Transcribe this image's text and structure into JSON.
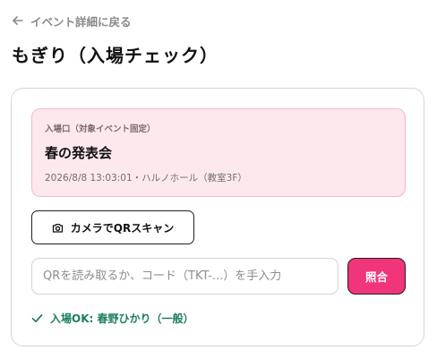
{
  "back_link": {
    "label": "イベント詳細に戻る",
    "icon": "arrow-left-icon"
  },
  "page": {
    "title": "もぎり（入場チェック）"
  },
  "event": {
    "label": "入場口（対象イベント固定）",
    "name": "春の発表会",
    "meta": "2026/8/8 13:03:01・ハルノホール（教室3F）"
  },
  "scanner": {
    "button_label": "カメラでQRスキャン",
    "icon": "camera-icon"
  },
  "manual_entry": {
    "placeholder": "QRを読み取るか、コード（TKT-...）を手入力",
    "value": "",
    "submit_label": "照合"
  },
  "result": {
    "status": "ok",
    "message": "入場OK: 春野ひかり（一般）",
    "icon": "check-icon"
  },
  "colors": {
    "accent": "#f0357a",
    "event_bg": "#fde8ee",
    "event_border": "#f2b9c8",
    "success": "#1a7f5a",
    "muted": "#8a8a8a"
  }
}
